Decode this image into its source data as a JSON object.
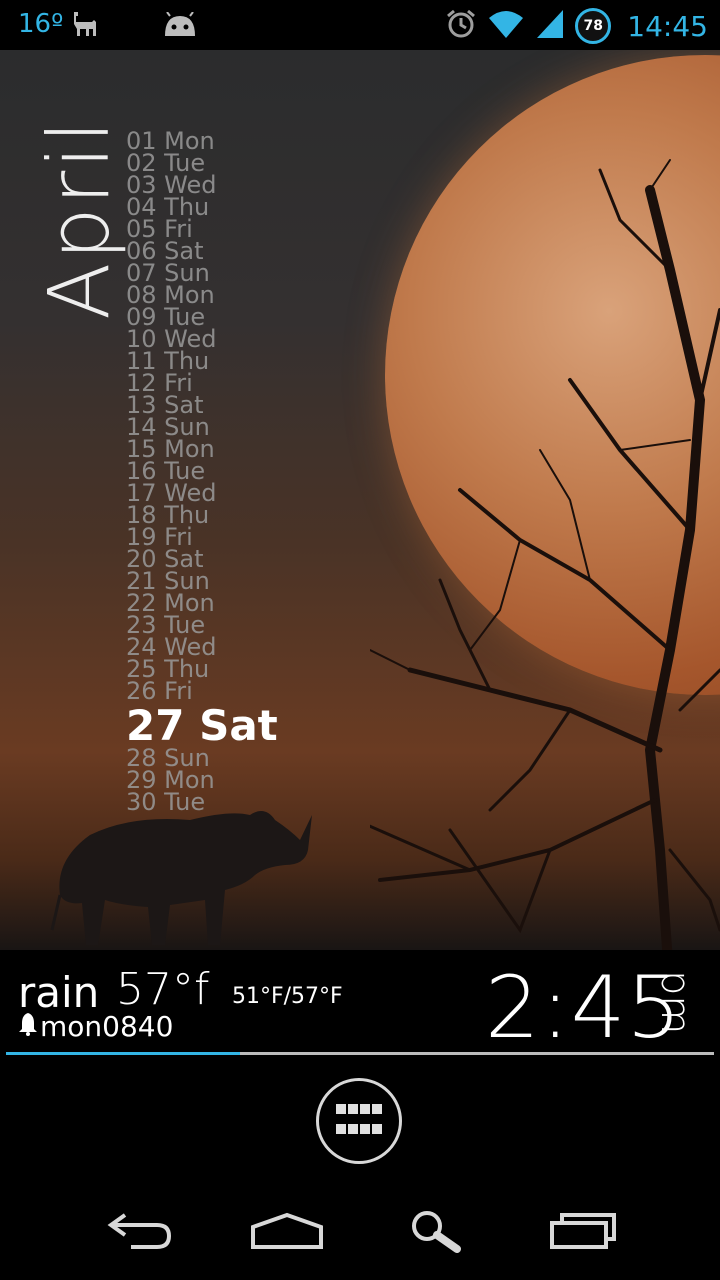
{
  "status_bar": {
    "temperature": "16º",
    "time": "14:45",
    "battery_badge": "78",
    "icons": [
      "llama-icon",
      "android-icon",
      "alarm-icon",
      "wifi-icon",
      "signal-icon",
      "battery-badge-icon"
    ]
  },
  "calendar": {
    "month": "April",
    "days": [
      "01 Mon",
      "02 Tue",
      "03 Wed",
      "04 Thu",
      "05 Fri",
      "06 Sat",
      "07 Sun",
      "08 Mon",
      "09 Tue",
      "10 Wed",
      "11 Thu",
      "12 Fri",
      "13 Sat",
      "14 Sun",
      "15 Mon",
      "16 Tue",
      "17 Wed",
      "18 Thu",
      "19 Fri",
      "20 Sat",
      "21 Sun",
      "22 Mon",
      "23 Tue",
      "24 Wed",
      "25 Thu",
      "26 Fri",
      "27 Sat",
      "28 Sun",
      "29 Mon",
      "30 Tue"
    ],
    "today_index": 26
  },
  "weather": {
    "condition": "rain",
    "temperature": "57°f",
    "range": "51°F/57°F"
  },
  "alarm": {
    "text": "mon0840"
  },
  "clock": {
    "time": "2:45",
    "ampm": "pm"
  },
  "progress": {
    "fraction": 0.33
  },
  "colors": {
    "accent": "#33b5e5"
  },
  "nav": [
    "back-icon",
    "home-icon",
    "search-icon",
    "recent-apps-icon"
  ]
}
